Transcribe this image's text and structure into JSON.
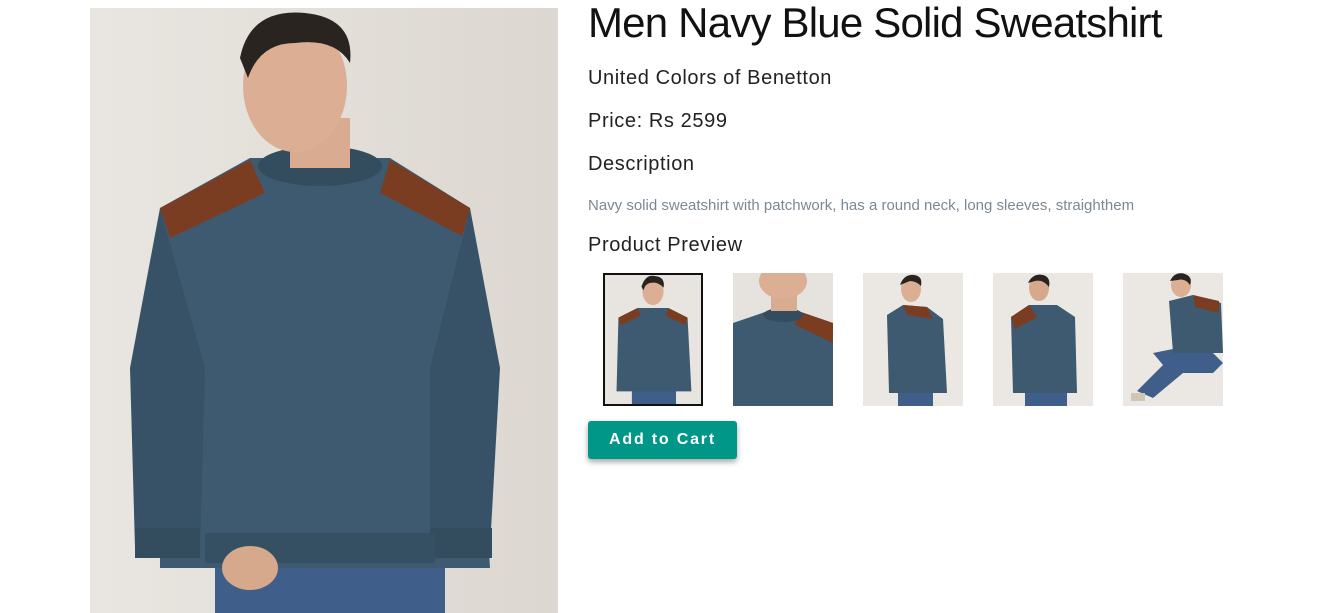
{
  "product": {
    "title": "Men Navy Blue Solid Sweatshirt",
    "brand": "United Colors of Benetton",
    "price": "Price: Rs 2599",
    "description_heading": "Description",
    "description": "Navy solid sweatshirt with patchwork, has a round neck, long sleeves, straighthem",
    "preview_heading": "Product Preview",
    "add_to_cart_label": "Add to Cart",
    "selected_preview": 1
  },
  "colors": {
    "accent": "#009688",
    "sweatshirt": "#3e5a70",
    "patch": "#7a3d22",
    "description_text": "#7b8894"
  }
}
